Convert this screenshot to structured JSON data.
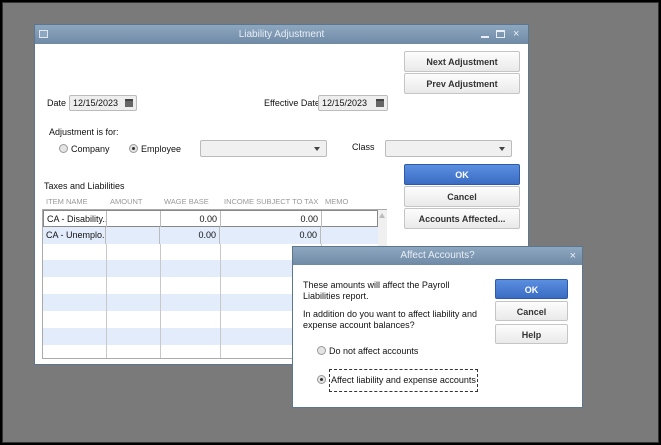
{
  "window": {
    "title": "Liability Adjustment"
  },
  "buttons": {
    "next": "Next Adjustment",
    "prev": "Prev Adjustment",
    "ok": "OK",
    "cancel": "Cancel",
    "accounts_affected": "Accounts Affected..."
  },
  "form": {
    "date_label": "Date",
    "date": "12/15/2023",
    "effective_label": "Effective Date",
    "effective_date": "12/15/2023",
    "adjustment_for": "Adjustment is for:",
    "company": "Company",
    "employee": "Employee",
    "selected": "Employee",
    "employee_value": "",
    "class_label": "Class",
    "class_value": ""
  },
  "table": {
    "title": "Taxes and Liabilities",
    "headers": [
      "ITEM NAME",
      "AMOUNT",
      "WAGE BASE",
      "INCOME SUBJECT TO TAX",
      "MEMO"
    ],
    "rows": [
      [
        "CA - Disability...",
        "",
        "0.00",
        "0.00",
        ""
      ],
      [
        "CA - Unemplo...",
        "",
        "0.00",
        "0.00",
        ""
      ]
    ]
  },
  "dialog": {
    "title": "Affect Accounts?",
    "text1": "These amounts will affect the Payroll Liabilities report.",
    "text2": "In addition do you want to affect liability and expense account balances?",
    "option1": "Do not affect accounts",
    "option2": "Affect liability and expense accounts",
    "selected": "option2",
    "ok": "OK",
    "cancel": "Cancel",
    "help": "Help"
  }
}
